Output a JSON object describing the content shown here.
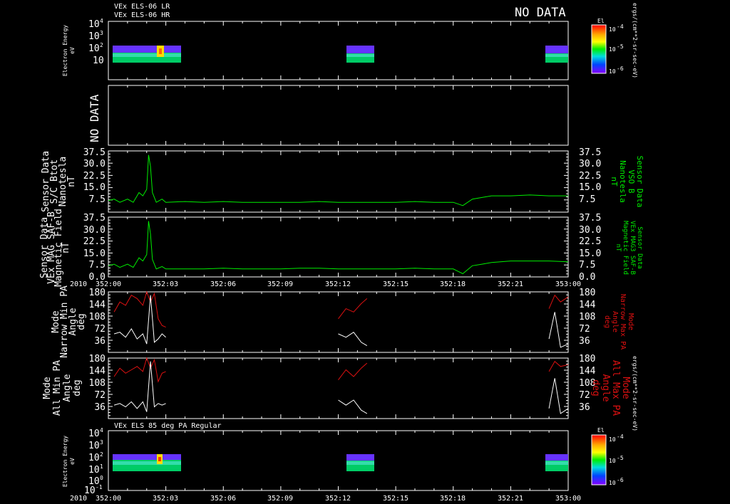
{
  "header": {
    "line1": "VEx ELS-06 LR",
    "line2": "VEx ELS-06 HR",
    "no_data": "NO DATA"
  },
  "spectrogram_panel": {
    "ylabel1": "Electron Energy",
    "ylabel2": "eV",
    "yticks": [
      "10",
      "10",
      "10",
      "10"
    ],
    "yexps": [
      "4",
      "3",
      "2",
      ""
    ],
    "colorbar_title": "El",
    "colorbar_ticks": [
      "10",
      "10",
      "10"
    ],
    "colorbar_exps": [
      "-4",
      "-5",
      "-6"
    ],
    "units": "ergs/(cm**2-sr-sec-eV)"
  },
  "nodata_panel": {
    "text": "NO DATA"
  },
  "colors": {
    "green": "#00ee00",
    "red": "#dd1111",
    "white": "#ffffff"
  },
  "mag_panel_1": {
    "left_label": [
      "Sensor Data",
      "S/C Btot",
      "Nanotesla",
      "nT"
    ],
    "right_label": [
      "Sensor Data",
      "VSO B",
      "Nanotesla",
      "nT"
    ],
    "yticks": [
      "37.5",
      "30.0",
      "22.5",
      "15.0",
      "7.5"
    ]
  },
  "mag_panel_2": {
    "left_label": [
      "Sensor Data",
      "VEx MAG SAF-B",
      "Magnetic Field",
      "nT"
    ],
    "right_label": [
      "Sensor Data",
      "VEx MAG3 SAF-B",
      "Magnetic Field",
      "nT"
    ],
    "yticks": [
      "37.5",
      "30.0",
      "22.5",
      "15.0",
      "7.5",
      "0.0"
    ]
  },
  "pa_panel_1": {
    "left_label": [
      "Mode",
      "Narrow Min PA",
      "Angle",
      "deg"
    ],
    "right_label": [
      "Mode",
      "Narrow Max PA",
      "Angle",
      "deg"
    ],
    "yticks": [
      "180",
      "144",
      "108",
      "72",
      "36"
    ]
  },
  "pa_panel_2": {
    "left_label": [
      "Mode",
      "All Min PA",
      "Angle",
      "deg"
    ],
    "right_label": [
      "Mode",
      "All Max PA",
      "Angle",
      "deg"
    ],
    "yticks": [
      "180",
      "144",
      "108",
      "72",
      "36"
    ]
  },
  "bottom_panel": {
    "title": "VEx ELS 85 deg PA Regular",
    "ylabel1": "Electron Energy",
    "ylabel2": "eV",
    "yticks": [
      "10",
      "10",
      "10",
      "10",
      "10",
      "10"
    ],
    "yexps": [
      "4",
      "3",
      "2",
      "1",
      "0",
      "-1"
    ],
    "colorbar_title": "El",
    "colorbar_ticks": [
      "10",
      "10",
      "10"
    ],
    "colorbar_exps": [
      "-4",
      "-5",
      "-6"
    ],
    "units": "ergs/(cm**2-sr-sec-eV)"
  },
  "time_axis": {
    "year": "2010",
    "ticks": [
      "352:00",
      "352:03",
      "352:06",
      "352:09",
      "352:12",
      "352:15",
      "352:18",
      "352:21",
      "353:00"
    ]
  },
  "chart_data": {
    "type": "line",
    "x_unit": "day-of-year hh:mm",
    "xlim": [
      "352:00",
      "353:00"
    ],
    "panels": [
      {
        "id": "mag_btot",
        "ylim": [
          0,
          37.5
        ],
        "series": [
          {
            "x": [
              "352:00",
              "352:00.3",
              "352:00.6",
              "352:01",
              "352:01.3",
              "352:01.6",
              "352:01.8",
              "352:02",
              "352:02.1",
              "352:02.2",
              "352:02.3",
              "352:02.5",
              "352:02.8",
              "352:03",
              "352:04",
              "352:05",
              "352:06",
              "352:07",
              "352:08",
              "352:09",
              "352:10",
              "352:11",
              "352:12",
              "352:13",
              "352:14",
              "352:15",
              "352:16",
              "352:17",
              "352:18",
              "352:18.5",
              "352:19",
              "352:19.5",
              "352:20",
              "352:21",
              "352:22",
              "352:23",
              "353:00"
            ],
            "y": [
              7,
              8,
              6,
              8,
              6,
              12,
              10,
              14,
              35,
              28,
              12,
              6,
              8,
              6,
              6.5,
              6,
              6.5,
              6,
              6,
              6,
              6,
              6.5,
              6,
              6,
              6,
              6,
              6.5,
              6,
              6,
              4,
              8,
              9,
              10,
              10,
              10.5,
              10,
              10
            ]
          }
        ]
      },
      {
        "id": "mag_saf",
        "ylim": [
          0,
          37.5
        ],
        "series": [
          {
            "x": [
              "352:00",
              "352:00.3",
              "352:00.6",
              "352:01",
              "352:01.3",
              "352:01.6",
              "352:01.8",
              "352:02",
              "352:02.1",
              "352:02.2",
              "352:02.3",
              "352:02.5",
              "352:02.8",
              "352:03",
              "352:04",
              "352:05",
              "352:06",
              "352:07",
              "352:08",
              "352:09",
              "352:10",
              "352:11",
              "352:12",
              "352:13",
              "352:14",
              "352:15",
              "352:16",
              "352:17",
              "352:18",
              "352:18.5",
              "352:19",
              "352:19.5",
              "352:20",
              "352:21",
              "352:22",
              "352:23",
              "353:00"
            ],
            "y": [
              7,
              8,
              6,
              8,
              6,
              12,
              10,
              14,
              35,
              27,
              11,
              5,
              6.5,
              5,
              5,
              5,
              5.5,
              5,
              5,
              5,
              5.5,
              5.5,
              5,
              5,
              5,
              5,
              5.5,
              5,
              5,
              2,
              7,
              8,
              9,
              10,
              10,
              10,
              9.5
            ]
          }
        ]
      },
      {
        "id": "pa_narrow",
        "ylim": [
          0,
          180
        ],
        "series": [
          {
            "color": "red",
            "segments": [
              {
                "x": [
                  "352:00.3",
                  "352:00.6",
                  "352:00.9",
                  "352:01.2",
                  "352:01.5",
                  "352:01.8",
                  "352:02",
                  "352:02.2",
                  "352:02.4",
                  "352:02.6",
                  "352:02.8",
                  "352:03"
                ],
                "y": [
                  120,
                  150,
                  140,
                  170,
                  160,
                  140,
                  180,
                  150,
                  175,
                  100,
                  80,
                  75
                ]
              },
              {
                "x": [
                  "352:12",
                  "352:12.4",
                  "352:12.8",
                  "352:13.2",
                  "352:13.5"
                ],
                "y": [
                  100,
                  130,
                  120,
                  145,
                  160
                ]
              },
              {
                "x": [
                  "352:23",
                  "352:23.3",
                  "352:23.6",
                  "352:24"
                ],
                "y": [
                  130,
                  170,
                  150,
                  165
                ]
              }
            ]
          },
          {
            "color": "white",
            "segments": [
              {
                "x": [
                  "352:00.3",
                  "352:00.6",
                  "352:00.9",
                  "352:01.2",
                  "352:01.5",
                  "352:01.8",
                  "352:02",
                  "352:02.2",
                  "352:02.4",
                  "352:02.6",
                  "352:02.8",
                  "352:03"
                ],
                "y": [
                  55,
                  60,
                  45,
                  70,
                  40,
                  55,
                  25,
                  170,
                  30,
                  40,
                  55,
                  45
                ]
              },
              {
                "x": [
                  "352:12",
                  "352:12.4",
                  "352:12.8",
                  "352:13.2",
                  "352:13.5"
                ],
                "y": [
                  55,
                  45,
                  60,
                  30,
                  20
                ]
              },
              {
                "x": [
                  "352:23",
                  "352:23.3",
                  "352:23.6",
                  "352:24"
                ],
                "y": [
                  40,
                  120,
                  15,
                  25
                ]
              }
            ]
          }
        ]
      },
      {
        "id": "pa_all",
        "ylim": [
          0,
          180
        ],
        "series": [
          {
            "color": "red",
            "segments": [
              {
                "x": [
                  "352:00.3",
                  "352:00.6",
                  "352:00.9",
                  "352:01.2",
                  "352:01.5",
                  "352:01.8",
                  "352:02",
                  "352:02.2",
                  "352:02.4",
                  "352:02.6",
                  "352:02.8",
                  "352:03"
                ],
                "y": [
                  125,
                  150,
                  135,
                  145,
                  155,
                  140,
                  180,
                  150,
                  175,
                  110,
                  135,
                  140
                ]
              },
              {
                "x": [
                  "352:12",
                  "352:12.4",
                  "352:12.8",
                  "352:13.2",
                  "352:13.5"
                ],
                "y": [
                  115,
                  145,
                  125,
                  150,
                  165
                ]
              },
              {
                "x": [
                  "352:23",
                  "352:23.3",
                  "352:23.6",
                  "352:24"
                ],
                "y": [
                  140,
                  170,
                  155,
                  160
                ]
              }
            ]
          },
          {
            "color": "white",
            "segments": [
              {
                "x": [
                  "352:00.3",
                  "352:00.6",
                  "352:00.9",
                  "352:01.2",
                  "352:01.5",
                  "352:01.8",
                  "352:02",
                  "352:02.2",
                  "352:02.4",
                  "352:02.6",
                  "352:02.8",
                  "352:03"
                ],
                "y": [
                  40,
                  45,
                  35,
                  50,
                  30,
                  50,
                  20,
                  170,
                  35,
                  45,
                  40,
                  45
                ]
              },
              {
                "x": [
                  "352:12",
                  "352:12.4",
                  "352:12.8",
                  "352:13.2",
                  "352:13.5"
                ],
                "y": [
                  55,
                  40,
                  55,
                  25,
                  15
                ]
              },
              {
                "x": [
                  "352:23",
                  "352:23.3",
                  "352:23.6",
                  "352:24"
                ],
                "y": [
                  30,
                  120,
                  15,
                  30
                ]
              }
            ]
          }
        ]
      }
    ]
  }
}
